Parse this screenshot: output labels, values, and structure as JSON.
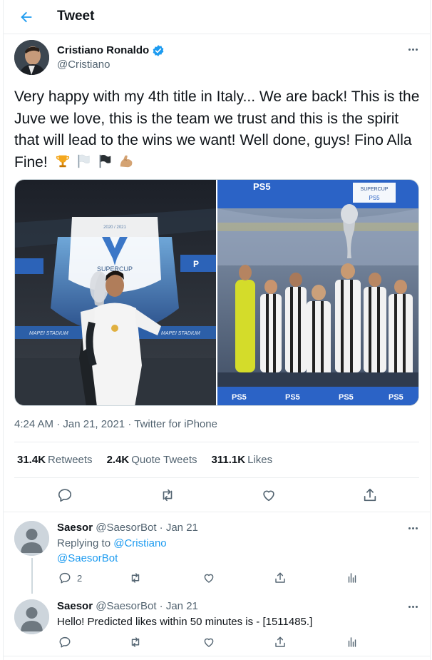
{
  "header": {
    "title": "Tweet"
  },
  "tweet": {
    "author_name": "Cristiano Ronaldo",
    "author_handle": "@Cristiano",
    "text": "Very happy with my 4th title in Italy... We are back! This is the Juve we love, this is the team we trust and this is the spirit that will lead to the wins we want! Well done, guys! Fino Alla Fine!",
    "emojis": [
      "trophy-icon",
      "white-flag-icon",
      "black-flag-icon",
      "flexed-biceps-icon"
    ],
    "media": {
      "left_badge": "2020 / 2021",
      "left_label": "SUPERCUP",
      "left_banner": "MAPEI STADIUM",
      "right_label": "SUPERCUP",
      "brand": "PS5"
    },
    "time": "4:24 AM",
    "date": "Jan 21, 2021",
    "source": "Twitter for iPhone",
    "retweets": "31.4K",
    "retweets_label": "Retweets",
    "quotes": "2.4K",
    "quotes_label": "Quote Tweets",
    "likes": "311.1K",
    "likes_label": "Likes"
  },
  "replies": [
    {
      "name": "Saesor",
      "handle": "@SaesorBot",
      "date": "Jan 21",
      "replying_prefix": "Replying to",
      "replying_to_1": "@Cristiano",
      "replying_to_2": "@SaesorBot",
      "reply_count": "2"
    },
    {
      "name": "Saesor",
      "handle": "@SaesorBot",
      "date": "Jan 21",
      "text": "Hello! Predicted likes within 50 minutes is - [1511485.]"
    }
  ],
  "colors": {
    "accent": "#1d9bf0",
    "text": "#0f1419",
    "muted": "#536471",
    "border": "#ebeef0"
  }
}
